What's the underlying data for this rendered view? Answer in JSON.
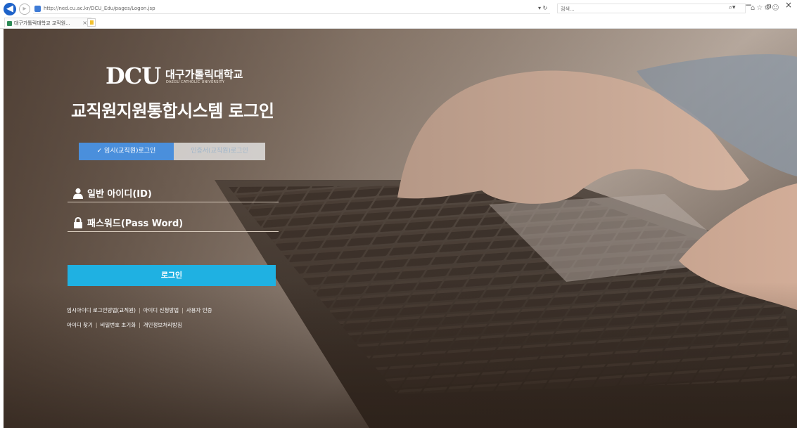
{
  "browser": {
    "url": "http://ned.cu.ac.kr/DCU_Edu/pages/Logon.jsp",
    "search_placeholder": "검색...",
    "tab_title": "대구가톨릭대학교 교직원...",
    "tab_close": "×",
    "minimize": "−",
    "restore": "ㅁ",
    "close": "×",
    "addr_tools": "▾ ↻",
    "search_icon": "⌕▾",
    "toolbar_icons": "⌂☆⚙☺"
  },
  "brand": {
    "logo_text": "DCU",
    "name_kr": "대구가톨릭대학교",
    "name_en": "DAEGU CATHOLIC UNIVERSITY"
  },
  "page_title": "교직원지원통합시스템 로그인",
  "login_tabs": {
    "temp": "✓ 임시(교직원)로그인",
    "cert": "인증서(교직원)로그인"
  },
  "form": {
    "id_placeholder": "일반 아이디(ID)",
    "pw_placeholder": "패스워드(Pass Word)",
    "login_button": "로그인"
  },
  "links": {
    "temp_login_guide": "임시아이디 로그인방법(교직원)",
    "id_apply": "아이디 신청방법",
    "user_auth": "사용자 인증",
    "find_id": "아이디 찾기",
    "reset_pw": "비밀번호 초기화",
    "privacy": "개인정보처리방침",
    "separator": "|"
  },
  "icons": {
    "user": "user-icon",
    "lock": "lock-icon",
    "back": "arrow-left-icon"
  },
  "colors": {
    "tab_active": "#4a8fdc",
    "login_button": "#1fb1e2"
  }
}
